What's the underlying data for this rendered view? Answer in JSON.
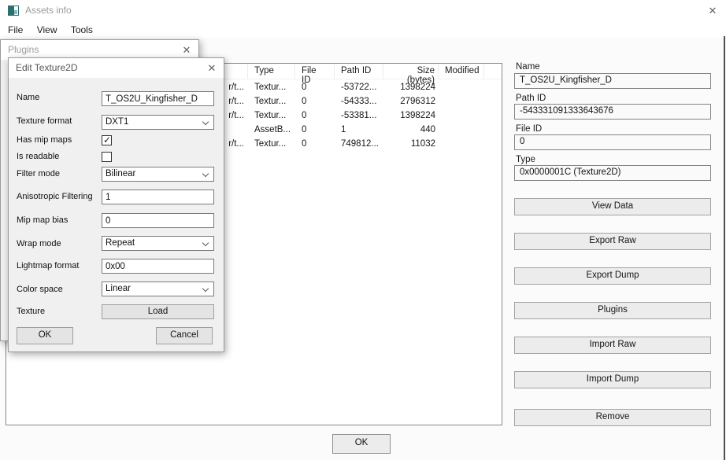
{
  "window": {
    "title": "Assets info"
  },
  "icons": {
    "close_glyph": "✕"
  },
  "menu": {
    "items": [
      "File",
      "View",
      "Tools"
    ]
  },
  "table": {
    "columns": [
      "Type",
      "File ID",
      "Path ID",
      "Size (bytes)",
      "Modified"
    ],
    "rows": [
      {
        "name_fragment": "r/t...",
        "type": "Textur...",
        "file_id": "0",
        "path_id": "-53722...",
        "size": "1398224",
        "modified": ""
      },
      {
        "name_fragment": "r/t...",
        "type": "Textur...",
        "file_id": "0",
        "path_id": "-54333...",
        "size": "2796312",
        "modified": ""
      },
      {
        "name_fragment": "r/t...",
        "type": "Textur...",
        "file_id": "0",
        "path_id": "-53381...",
        "size": "1398224",
        "modified": ""
      },
      {
        "name_fragment": "",
        "type": "AssetB...",
        "file_id": "0",
        "path_id": "1",
        "size": "440",
        "modified": ""
      },
      {
        "name_fragment": "r/t...",
        "type": "Textur...",
        "file_id": "0",
        "path_id": "749812...",
        "size": "11032",
        "modified": ""
      }
    ]
  },
  "right_panel": {
    "name_label": "Name",
    "name_value": "T_OS2U_Kingfisher_D",
    "path_id_label": "Path ID",
    "path_id_value": "-543331091333643676",
    "file_id_label": "File ID",
    "file_id_value": "0",
    "type_label": "Type",
    "type_value": "0x0000001C (Texture2D)",
    "buttons": [
      "View Data",
      "Export Raw",
      "Export Dump",
      "Plugins",
      "Import Raw",
      "Import Dump",
      "Remove"
    ]
  },
  "footer": {
    "ok_label": "OK"
  },
  "plugins_window": {
    "title": "Plugins"
  },
  "edit_dialog": {
    "title": "Edit Texture2D",
    "fields": {
      "name": {
        "label": "Name",
        "value": "T_OS2U_Kingfisher_D"
      },
      "texture_format": {
        "label": "Texture format",
        "value": "DXT1"
      },
      "has_mip_maps": {
        "label": "Has mip maps",
        "checked": true
      },
      "is_readable": {
        "label": "Is readable",
        "checked": false
      },
      "filter_mode": {
        "label": "Filter mode",
        "value": "Bilinear"
      },
      "anisotropic_filtering": {
        "label": "Anisotropic Filtering",
        "value": "1"
      },
      "mip_map_bias": {
        "label": "Mip map bias",
        "value": "0"
      },
      "wrap_mode": {
        "label": "Wrap mode",
        "value": "Repeat"
      },
      "lightmap_format": {
        "label": "Lightmap format",
        "value": "0x00"
      },
      "color_space": {
        "label": "Color space",
        "value": "Linear"
      },
      "texture": {
        "label": "Texture",
        "button_label": "Load"
      }
    },
    "ok_label": "OK",
    "cancel_label": "Cancel"
  },
  "colors": {
    "teal_icon": "#2c7070",
    "dialog_bg": "#f0f0f0",
    "border": "#7a7a7a"
  }
}
